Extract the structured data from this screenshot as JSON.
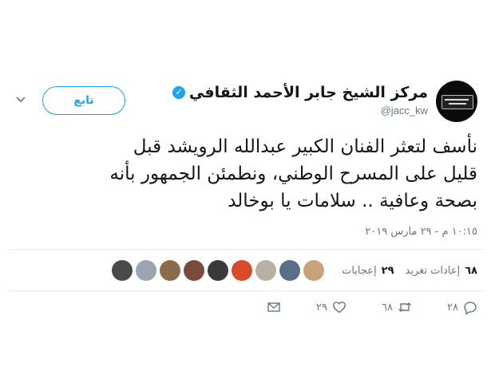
{
  "header": {
    "display_name": "مركز الشيخ جابر الأحمد الثقافي",
    "handle": "@jacc_kw",
    "follow_label": "تابع"
  },
  "tweet": {
    "text": "نأسف لتعثر الفنان الكبير عبدالله الرويشد قبل\nقليل على المسرح الوطني، ونطمئن الجمهور بأنه\nبصحة وعافية .. سلامات يا بوخالد",
    "timestamp": "١٠:١٥ م - ٢٩ مارس ٢٠١٩"
  },
  "stats": {
    "retweets_count": "٦٨",
    "retweets_label": "إعادات تغريد",
    "likes_count": "٢٩",
    "likes_label": "إعجابات",
    "liker_avatar_colors": [
      "#c9a27a",
      "#5a6e8a",
      "#b8b0a0",
      "#d94a2a",
      "#3a3a3a",
      "#7a4a3a",
      "#8b6b4b",
      "#9aa5b1",
      "#4a4a4a"
    ]
  },
  "actions": {
    "reply_count": "٢٨",
    "retweet_count": "٦٨",
    "like_count": "٢٩"
  },
  "colors": {
    "accent": "#1da1f2",
    "muted": "#657786",
    "divider": "#e6ecf0"
  },
  "icons": [
    "verified-icon",
    "chevron-down-icon",
    "reply-icon",
    "retweet-icon",
    "heart-icon",
    "direct-message-icon"
  ]
}
